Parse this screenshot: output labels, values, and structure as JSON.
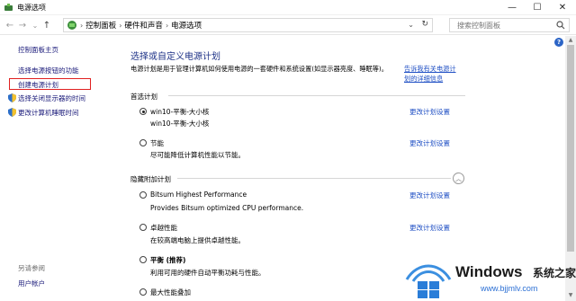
{
  "window": {
    "title": "电源选项",
    "controls": {
      "minimize": "—",
      "maximize": "☐",
      "close": "✕"
    }
  },
  "nav": {
    "back": "←",
    "forward": "→",
    "recent": "⌄",
    "up": "↑",
    "breadcrumbs": [
      "控制面板",
      "硬件和声音",
      "电源选项"
    ],
    "separator": "›",
    "search_placeholder": "搜索控制面板"
  },
  "sidebar": {
    "home": "控制面板主页",
    "items": [
      {
        "label": "选择电源按钮的功能"
      },
      {
        "label": "创建电源计划"
      },
      {
        "label": "选择关闭显示器的时间"
      },
      {
        "label": "更改计算机睡眠时间"
      }
    ],
    "see_also_title": "另请参阅",
    "see_also_items": [
      {
        "label": "用户帐户"
      }
    ]
  },
  "main": {
    "heading": "选择或自定义电源计划",
    "description": "电源计划是用于管理计算机如何使用电源的一套硬件和系统设置(如显示器亮度、睡眠等)。",
    "description_link": "告诉我有关电源计划的详细信息",
    "preferred_section": "首选计划",
    "hidden_section": "隐藏附加计划",
    "change_link": "更改计划设置",
    "plans": [
      {
        "name": "win10-平衡-大小核",
        "desc": "win10-平衡-大小核",
        "checked": true
      },
      {
        "name": "节能",
        "desc": "尽可能降低计算机性能以节能。",
        "checked": false
      },
      {
        "name": "Bitsum Highest Performance",
        "desc": "Provides Bitsum optimized CPU performance.",
        "checked": false
      },
      {
        "name": "卓越性能",
        "desc": "在较高端电脑上提供卓越性能。",
        "checked": false
      },
      {
        "name": "平衡 (推荐)",
        "desc": "利用可用的硬件自动平衡功耗与性能。",
        "checked": false
      },
      {
        "name": "最大性能叠加",
        "desc": "",
        "checked": false
      }
    ]
  },
  "help": "?",
  "watermark": {
    "brand": "Windows",
    "cn": "系统之家",
    "url": "www.bjjmlv.com"
  }
}
